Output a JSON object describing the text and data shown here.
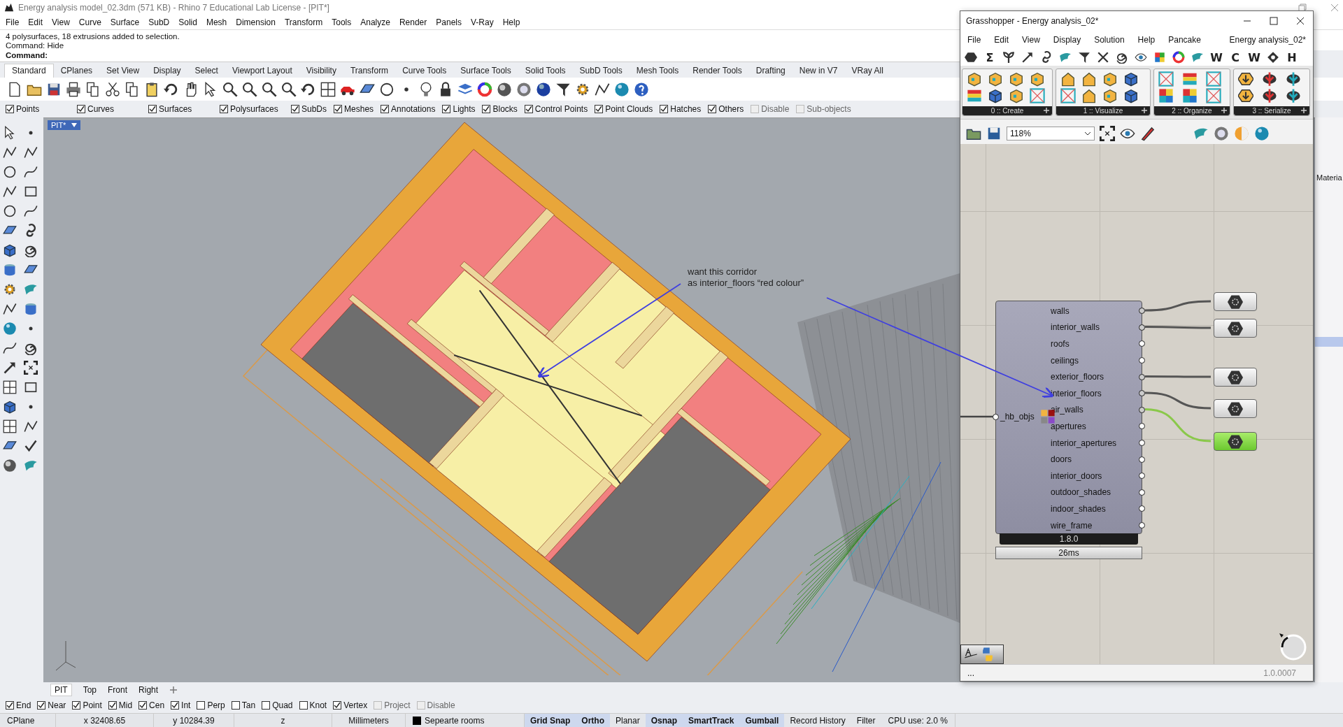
{
  "window": {
    "title": "Energy analysis model_02.3dm (571 KB) - Rhino 7 Educational Lab License - [PIT*]"
  },
  "menu": [
    "File",
    "Edit",
    "View",
    "Curve",
    "Surface",
    "SubD",
    "Solid",
    "Mesh",
    "Dimension",
    "Transform",
    "Tools",
    "Analyze",
    "Render",
    "Panels",
    "V-Ray",
    "Help"
  ],
  "command_history": [
    "4 polysurfaces, 18 extrusions added to selection.",
    "Command: Hide"
  ],
  "command_prompt": "Command:",
  "toolbar_tabs": [
    {
      "label": "Standard",
      "selected": true
    },
    {
      "label": "CPlanes",
      "selected": false
    },
    {
      "label": "Set View",
      "selected": false
    },
    {
      "label": "Display",
      "selected": false
    },
    {
      "label": "Select",
      "selected": false
    },
    {
      "label": "Viewport Layout",
      "selected": false
    },
    {
      "label": "Visibility",
      "selected": false
    },
    {
      "label": "Transform",
      "selected": false
    },
    {
      "label": "Curve Tools",
      "selected": false
    },
    {
      "label": "Surface Tools",
      "selected": false
    },
    {
      "label": "Solid Tools",
      "selected": false
    },
    {
      "label": "SubD Tools",
      "selected": false
    },
    {
      "label": "Mesh Tools",
      "selected": false
    },
    {
      "label": "Render Tools",
      "selected": false
    },
    {
      "label": "Drafting",
      "selected": false
    },
    {
      "label": "New in V7",
      "selected": false
    },
    {
      "label": "VRay All",
      "selected": false
    }
  ],
  "selection_filters": [
    {
      "label": "Points",
      "checked": true,
      "disabled": false
    },
    {
      "label": "Curves",
      "checked": true,
      "disabled": false
    },
    {
      "label": "Surfaces",
      "checked": true,
      "disabled": false
    },
    {
      "label": "Polysurfaces",
      "checked": true,
      "disabled": false
    },
    {
      "label": "SubDs",
      "checked": true,
      "disabled": false
    },
    {
      "label": "Meshes",
      "checked": true,
      "disabled": false
    },
    {
      "label": "Annotations",
      "checked": true,
      "disabled": false
    },
    {
      "label": "Lights",
      "checked": true,
      "disabled": false
    },
    {
      "label": "Blocks",
      "checked": true,
      "disabled": false
    },
    {
      "label": "Control Points",
      "checked": true,
      "disabled": false
    },
    {
      "label": "Point Clouds",
      "checked": true,
      "disabled": false
    },
    {
      "label": "Hatches",
      "checked": true,
      "disabled": false
    },
    {
      "label": "Others",
      "checked": true,
      "disabled": false
    },
    {
      "label": "Disable",
      "checked": false,
      "disabled": true
    },
    {
      "label": "Sub-objects",
      "checked": false,
      "disabled": true
    }
  ],
  "viewport": {
    "name": "PIT*",
    "annotation": [
      "want this corridor",
      "as interior_floors “red colour”"
    ]
  },
  "right_panel": {
    "tab": "Materia"
  },
  "viewport_tabs": [
    {
      "label": "PIT",
      "selected": true
    },
    {
      "label": "Top",
      "selected": false
    },
    {
      "label": "Front",
      "selected": false
    },
    {
      "label": "Right",
      "selected": false
    }
  ],
  "osnaps": [
    {
      "label": "End",
      "checked": true,
      "disabled": false
    },
    {
      "label": "Near",
      "checked": true,
      "disabled": false
    },
    {
      "label": "Point",
      "checked": true,
      "disabled": false
    },
    {
      "label": "Mid",
      "checked": true,
      "disabled": false
    },
    {
      "label": "Cen",
      "checked": true,
      "disabled": false
    },
    {
      "label": "Int",
      "checked": true,
      "disabled": false
    },
    {
      "label": "Perp",
      "checked": false,
      "disabled": false
    },
    {
      "label": "Tan",
      "checked": false,
      "disabled": false
    },
    {
      "label": "Quad",
      "checked": false,
      "disabled": false
    },
    {
      "label": "Knot",
      "checked": false,
      "disabled": false
    },
    {
      "label": "Vertex",
      "checked": true,
      "disabled": false
    },
    {
      "label": "Project",
      "checked": false,
      "disabled": true
    },
    {
      "label": "Disable",
      "checked": false,
      "disabled": true
    }
  ],
  "status_bar": {
    "cplane": "CPlane",
    "x": "x 32408.65",
    "y": "y 10284.39",
    "z": "z",
    "units": "Millimeters",
    "layer": {
      "name": "Sepearte rooms",
      "color": "#000000"
    },
    "toggles": [
      {
        "label": "Grid Snap",
        "on": true
      },
      {
        "label": "Ortho",
        "on": true
      },
      {
        "label": "Planar",
        "on": false
      },
      {
        "label": "Osnap",
        "on": true
      },
      {
        "label": "SmartTrack",
        "on": true
      },
      {
        "label": "Gumball",
        "on": true
      },
      {
        "label": "Record History",
        "on": false
      },
      {
        "label": "Filter",
        "on": false
      }
    ],
    "cpu": "CPU use: 2.0 %"
  },
  "grasshopper": {
    "title": "Grasshopper - Energy analysis_02*",
    "menu": [
      "File",
      "Edit",
      "View",
      "Display",
      "Solution",
      "Help",
      "Pancake"
    ],
    "document": "Energy analysis_02*",
    "tab_letters": [
      "Σ",
      "W",
      "C",
      "W",
      "H"
    ],
    "ribbon": [
      {
        "label": "0 :: Create"
      },
      {
        "label": "1 :: Visualize"
      },
      {
        "label": "2 :: Organize"
      },
      {
        "label": "3 :: Serialize"
      }
    ],
    "zoom": "118%",
    "component": {
      "input": "_hb_objs",
      "outputs": [
        {
          "label": "walls",
          "connected": true
        },
        {
          "label": "interior_walls",
          "connected": true
        },
        {
          "label": "roofs",
          "connected": false
        },
        {
          "label": "ceilings",
          "connected": false
        },
        {
          "label": "exterior_floors",
          "connected": true
        },
        {
          "label": "interior_floors",
          "connected": true
        },
        {
          "label": "air_walls",
          "connected": true
        },
        {
          "label": "apertures",
          "connected": false
        },
        {
          "label": "interior_apertures",
          "connected": false
        },
        {
          "label": "doors",
          "connected": false
        },
        {
          "label": "interior_doors",
          "connected": false
        },
        {
          "label": "outdoor_shades",
          "connected": false
        },
        {
          "label": "indoor_shades",
          "connected": false
        },
        {
          "label": "wire_frame",
          "connected": false
        }
      ],
      "version": "1.8.0",
      "timing": "26ms"
    },
    "previews": [
      {
        "selected": false
      },
      {
        "selected": false
      },
      {
        "selected": false
      },
      {
        "selected": false
      },
      {
        "selected": true
      }
    ],
    "status": "...",
    "version": "1.0.0007"
  }
}
